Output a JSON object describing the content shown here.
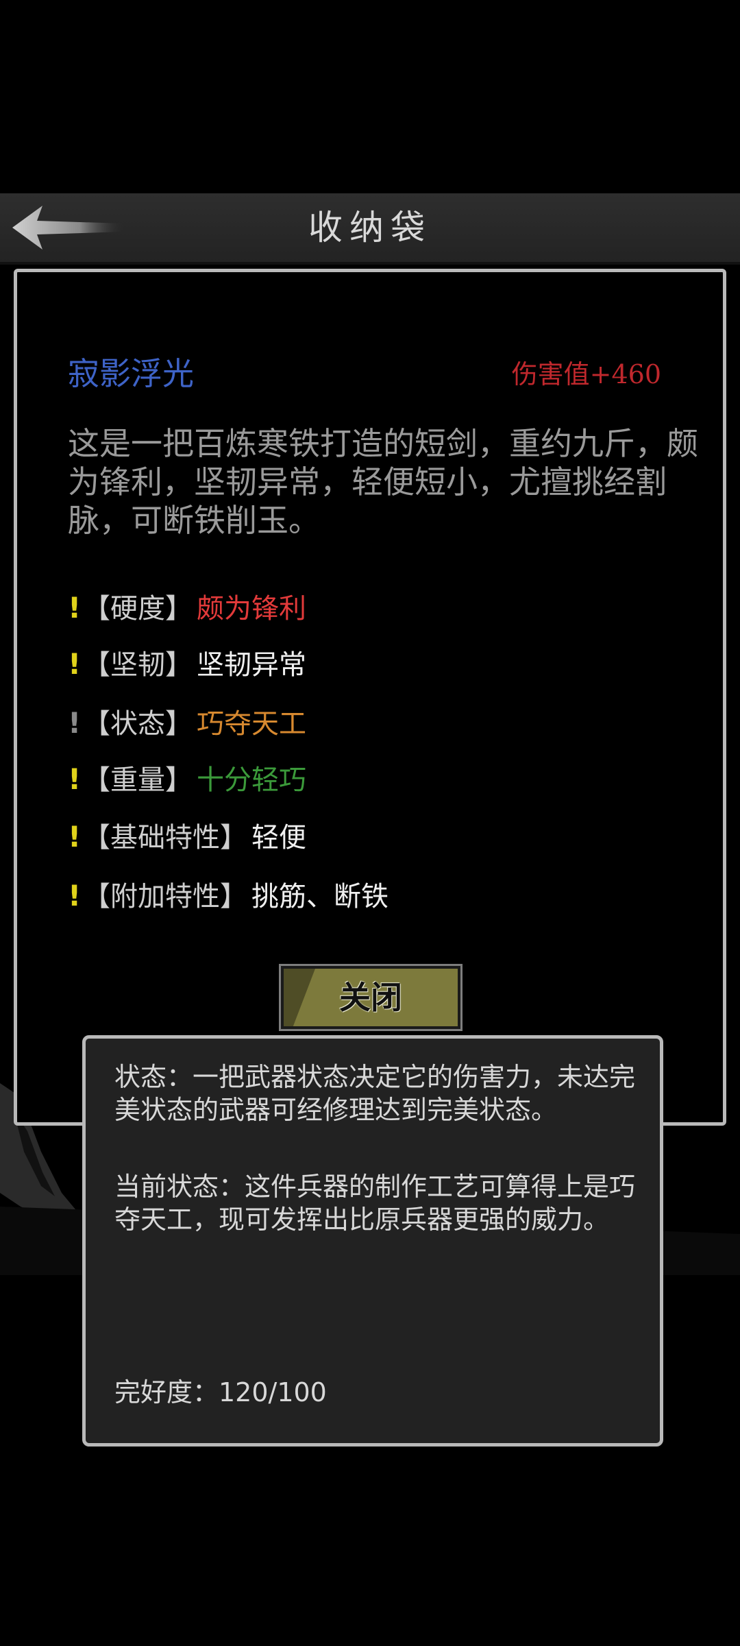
{
  "header": {
    "title": "收纳袋",
    "back_icon": "back-arrow-icon"
  },
  "item": {
    "name": "寂影浮光",
    "damage": "伤害值+460",
    "description": "这是一把百炼寒铁打造的短剑，重约九斤，颇为锋利，坚韧异常，轻便短小，尤擅挑经割脉，可断铁削玉。",
    "attributes": [
      {
        "mark": "!",
        "key": "【硬度】",
        "value": "颇为锋利",
        "color": "#e23a3a"
      },
      {
        "mark": "!",
        "key": "【坚韧】",
        "value": "坚韧异常",
        "color": "#f0f0f0"
      },
      {
        "mark": "!",
        "key": "【状态】",
        "value": "巧夺天工",
        "color": "#d7892f"
      },
      {
        "mark": "!",
        "key": "【重量】",
        "value": "十分轻巧",
        "color": "#3b9a3a"
      },
      {
        "mark": "!",
        "key": "【基础特性】",
        "value": "轻便",
        "color": "#f0f0f0"
      },
      {
        "mark": "!",
        "key": "【附加特性】",
        "value": "挑筋、断铁",
        "color": "#f0f0f0"
      }
    ],
    "close_label": "关闭"
  },
  "tooltip": {
    "state_desc": "状态：一把武器状态决定它的伤害力，未达完美状态的武器可经修理达到完美状态。",
    "current_state": "当前状态：这件兵器的制作工艺可算得上是巧夺天工，现可发挥出比原兵器更强的威力。",
    "durability": "完好度：120/100"
  },
  "colors": {
    "item_name": "#3e63c7",
    "damage": "#c0282d",
    "mark": "#e0d21a",
    "button": "#7d7a3c"
  }
}
